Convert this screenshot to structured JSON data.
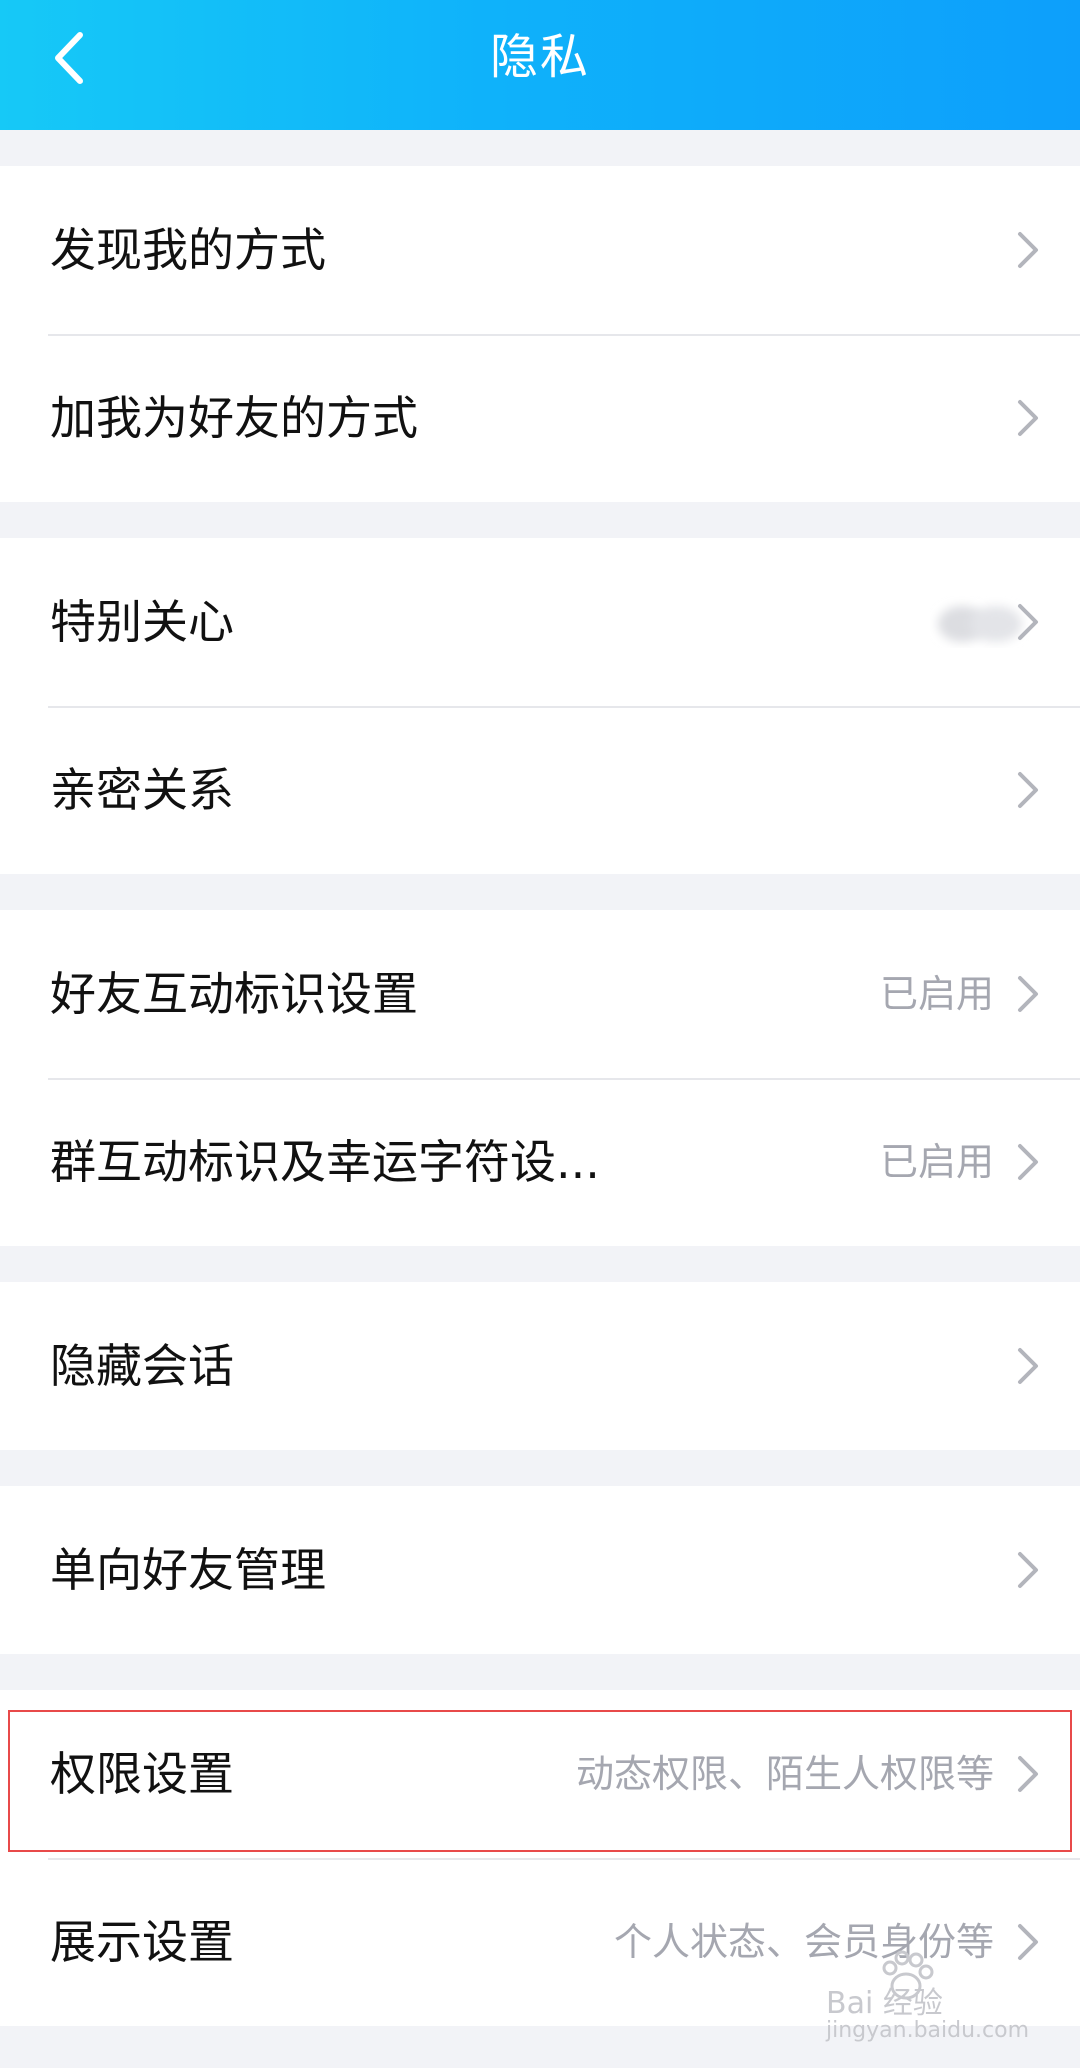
{
  "header": {
    "title": "隐私",
    "back_icon": "chevron-left-icon"
  },
  "groups": [
    {
      "items": [
        {
          "label": "发现我的方式",
          "value": ""
        },
        {
          "label": "加我为好友的方式",
          "value": ""
        }
      ]
    },
    {
      "items": [
        {
          "label": "特别关心",
          "value": ""
        },
        {
          "label": "亲密关系",
          "value": ""
        }
      ]
    },
    {
      "items": [
        {
          "label": "好友互动标识设置",
          "value": "已启用"
        },
        {
          "label": "群互动标识及幸运字符设...",
          "value": "已启用"
        }
      ]
    },
    {
      "items": [
        {
          "label": "隐藏会话",
          "value": ""
        }
      ]
    },
    {
      "items": [
        {
          "label": "单向好友管理",
          "value": ""
        }
      ]
    },
    {
      "items": [
        {
          "label": "权限设置",
          "value": "动态权限、陌生人权限等"
        },
        {
          "label": "展示设置",
          "value": "个人状态、会员身份等"
        }
      ]
    }
  ],
  "watermark": {
    "brand": "Bai 经验",
    "url": "jingyan.baidu.com"
  },
  "colors": {
    "header_start": "#16c9f7",
    "header_end": "#0d9ffb",
    "background": "#f2f3f7",
    "highlight": "#e84a4a",
    "value_text": "#a5a7b0"
  }
}
